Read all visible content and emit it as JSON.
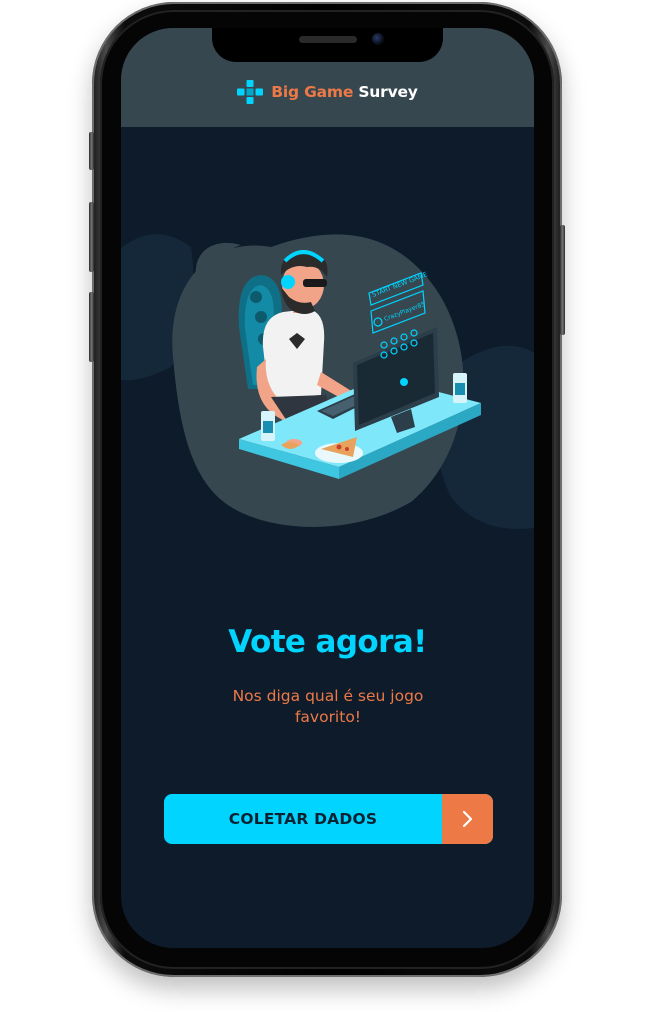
{
  "header": {
    "brand_part1": "Big Game",
    "brand_part2": "Survey",
    "logo_icon": "gamepad-cross-icon"
  },
  "hero": {
    "illustration": "gamer-at-desk-illustration",
    "screen_text_start": "START NEW GAME",
    "screen_text_player": "CrazyPlayer85"
  },
  "main": {
    "title": "Vote agora!",
    "subtitle": "Nos diga qual é seu jogo favorito!",
    "cta_label": "COLETAR DADOS",
    "cta_icon": "chevron-right-icon"
  },
  "colors": {
    "background": "#0d1b2a",
    "header": "#37474f",
    "primary": "#00d4ff",
    "accent": "#ed7947"
  }
}
